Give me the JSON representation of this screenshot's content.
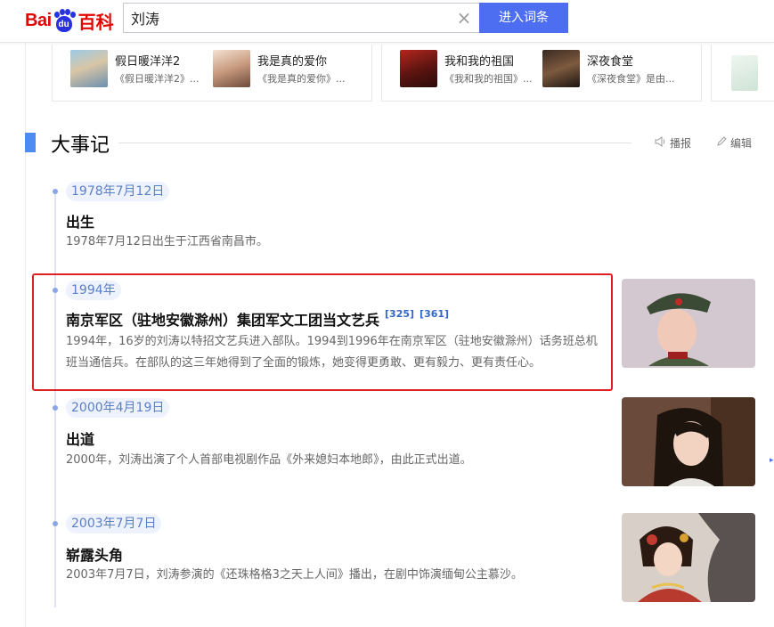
{
  "header": {
    "logo": {
      "bai": "Bai",
      "du": "du",
      "baike": "百科"
    },
    "search_value": "刘涛",
    "search_button": "进入词条"
  },
  "related_works": [
    {
      "title": "假日暖洋洋2",
      "desc": "《假日暖洋洋2》..."
    },
    {
      "title": "我是真的爱你",
      "desc": "《我是真的爱你》..."
    },
    {
      "title": "我和我的祖国",
      "desc": "《我和我的祖国》..."
    },
    {
      "title": "深夜食堂",
      "desc": "《深夜食堂》是由..."
    }
  ],
  "section": {
    "title": "大事记",
    "report_label": "播报",
    "edit_label": "编辑"
  },
  "events": [
    {
      "date": "1978年7月12日",
      "heading": "出生",
      "body": "1978年7月12日出生于江西省南昌市。",
      "refs": []
    },
    {
      "date": "1994年",
      "heading": "南京军区（驻地安徽滁州）集团军文工团当文艺兵",
      "body": "1994年，16岁的刘涛以特招文艺兵进入部队。1994到1996年在南京军区（驻地安徽滁州）话务班总机班当通信兵。在部队的这三年她得到了全面的锻炼，她变得更勇敢、更有毅力、更有责任心。",
      "refs": [
        "[325]",
        "[361]"
      ]
    },
    {
      "date": "2000年4月19日",
      "heading": "出道",
      "body": "2000年，刘涛出演了个人首部电视剧作品《外来媳妇本地郎》，由此正式出道。",
      "refs": []
    },
    {
      "date": "2003年7月7日",
      "heading": "崭露头角",
      "body": "2003年7月7日，刘涛参演的《还珠格格3之天上人间》播出，在剧中饰演缅甸公主慕沙。",
      "refs": []
    }
  ],
  "colors": {
    "brand_red": "#e10602",
    "brand_blue": "#2932e1",
    "button_blue": "#4e6ef2",
    "highlight_border": "#e02020",
    "section_bar": "#4e8cf2"
  }
}
